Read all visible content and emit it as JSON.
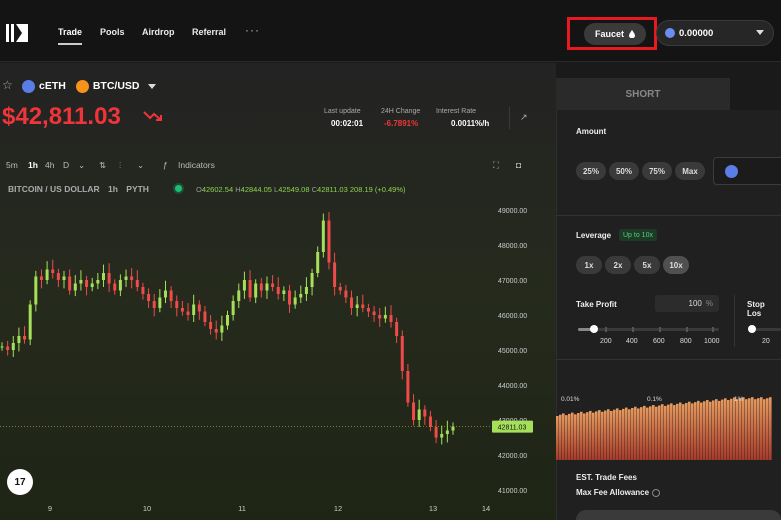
{
  "nav": {
    "items": [
      "Trade",
      "Pools",
      "Airdrop",
      "Referral"
    ],
    "more": "···",
    "faucet_label": "Faucet",
    "wallet_balance": "0.00000"
  },
  "market": {
    "collateral": "cETH",
    "pair": "BTC/USD",
    "price": "$42,811.03",
    "last_update_label": "Last update",
    "last_update_value": "00:02:01",
    "change_label": "24H Change",
    "change_value": "-6.7891%",
    "interest_label": "Interest Rate",
    "interest_value": "0.0011%/h"
  },
  "toolbar": {
    "timeframes": [
      "5m",
      "1h",
      "4h",
      "D"
    ],
    "indicators_label": "Indicators"
  },
  "chart_header": {
    "symbol": "BITCOIN / US DOLLAR",
    "interval": "1h",
    "source": "PYTH",
    "o_label": "O",
    "o": "42602.54",
    "h_label": "H",
    "h": "42844.05",
    "l_label": "L",
    "l": "42549.08",
    "c_label": "C",
    "c": "42811.03",
    "change": "208.19 (+0.49%)"
  },
  "chart_data": {
    "type": "candlestick",
    "y_ticks": [
      "49000.00",
      "48000.00",
      "47000.00",
      "46000.00",
      "45000.00",
      "44000.00",
      "43000.00",
      "42000.00",
      "41000.00"
    ],
    "ylim": [
      41000,
      49000
    ],
    "x_ticks": [
      "9",
      "10",
      "11",
      "12",
      "13",
      "14"
    ],
    "last_price": "42811.03",
    "up_color": "#a6e05a",
    "down_color": "#ef4b4b",
    "values": [
      45100,
      45000,
      45200,
      45400,
      45300,
      46300,
      47100,
      47000,
      47300,
      47200,
      47000,
      47100,
      46700,
      46900,
      47000,
      46800,
      46900,
      47000,
      47200,
      46900,
      46700,
      47000,
      47100,
      47000,
      46800,
      46600,
      46400,
      46200,
      46500,
      46700,
      46400,
      46200,
      46100,
      46000,
      46300,
      46100,
      45800,
      45600,
      45500,
      45700,
      46000,
      46400,
      46700,
      47000,
      46500,
      46900,
      46700,
      46900,
      46800,
      46600,
      46700,
      46300,
      46500,
      46600,
      46800,
      47200,
      47800,
      48700,
      47500,
      46800,
      46700,
      46500,
      46200,
      46300,
      46200,
      46100,
      46000,
      45900,
      46000,
      45800,
      45400,
      44400,
      43500,
      43000,
      43300,
      43100,
      42800,
      42500,
      42600,
      42700,
      42811
    ]
  },
  "panel": {
    "tab_short": "SHORT",
    "amount_label": "Amount",
    "amount_chips": [
      "25%",
      "50%",
      "75%",
      "Max"
    ],
    "leverage_label": "Leverage",
    "leverage_badge": "Up to 10x",
    "leverage_chips": [
      "1x",
      "2x",
      "5x",
      "10x"
    ],
    "take_profit_label": "Take Profit",
    "take_profit_value": "100",
    "take_profit_unit": "%",
    "tp_ticks": [
      "200",
      "400",
      "600",
      "800",
      "1000"
    ],
    "stop_loss_label": "Stop Los",
    "sl_tick": "20",
    "depth_labels": [
      "0.01%",
      "0.1%",
      "1%"
    ],
    "fee_label": "EST. Trade Fees",
    "max_fee_label": "Max Fee Allowance"
  }
}
